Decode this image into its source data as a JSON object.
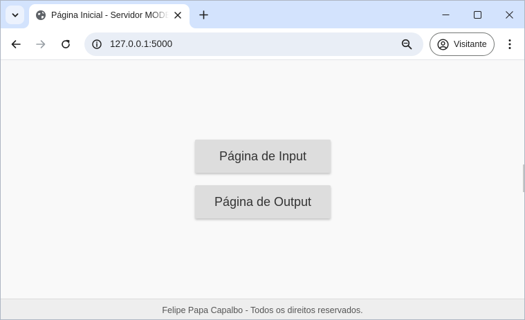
{
  "browser": {
    "tab": {
      "title": "Página Inicial - Servidor MODBUS",
      "favicon": "globe-icon"
    },
    "address_bar": {
      "url": "127.0.0.1:5000",
      "site_info_icon": "info-icon",
      "zoom_icon": "zoom-icon"
    },
    "profile": {
      "label": "Visitante",
      "icon": "account-circle-icon"
    },
    "colors": {
      "tabstrip": "#d3e3fd",
      "omnibox": "#e9eef6"
    }
  },
  "page": {
    "buttons": {
      "input_label": "Página de Input",
      "output_label": "Página de Output"
    },
    "footer": {
      "text": "Felipe Papa Capalbo - Todos os direitos reservados."
    },
    "colors": {
      "background": "#f9f9f9",
      "button": "#dddddd",
      "footer": "#eeeeee"
    }
  }
}
